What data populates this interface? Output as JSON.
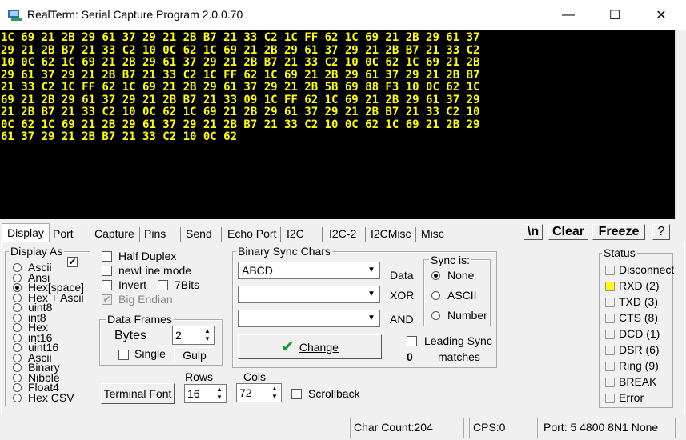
{
  "window": {
    "title": "RealTerm: Serial Capture Program 2.0.0.70",
    "minimize_icon": "minimize-icon",
    "maximize_icon": "maximize-icon",
    "close_icon": "close-icon",
    "minimize_glyph": "—",
    "maximize_glyph": "☐",
    "close_glyph": "✕"
  },
  "terminal": {
    "text_color": "#ffff00",
    "lines": [
      "1C 69 21 2B 29 61 37 29 21 2B B7 21 33 C2 1C FF 62 1C 69 21 2B 29 61 37",
      "29 21 2B B7 21 33 C2 10 0C 62 1C 69 21 2B 29 61 37 29 21 2B B7 21 33 C2",
      "10 0C 62 1C 69 21 2B 29 61 37 29 21 2B B7 21 33 C2 10 0C 62 1C 69 21 2B",
      "29 61 37 29 21 2B B7 21 33 C2 1C FF 62 1C 69 21 2B 29 61 37 29 21 2B B7",
      "21 33 C2 1C FF 62 1C 69 21 2B 29 61 37 29 21 2B 5B 69 88 F3 10 0C 62 1C",
      "69 21 2B 29 61 37 29 21 2B B7 21 33 09 1C FF 62 1C 69 21 2B 29 61 37 29",
      "21 2B B7 21 33 C2 10 0C 62 1C 69 21 2B 29 61 37 29 21 2B B7 21 33 C2 10",
      "0C 62 1C 69 21 2B 29 61 37 29 21 2B B7 21 33 C2 10 0C 62 1C 69 21 2B 29",
      "61 37 29 21 2B B7 21 33 C2 10 0C 62"
    ]
  },
  "tabs": [
    "Display",
    "Port",
    "Capture",
    "Pins",
    "Send",
    "Echo Port",
    "I2C",
    "I2C-2",
    "I2CMisc",
    "Misc"
  ],
  "toolbar": {
    "newline_label": "\\n",
    "clear_label": "Clear",
    "freeze_label": "Freeze",
    "help_label": "?"
  },
  "display_as": {
    "label": "Display As",
    "options": [
      "Ascii",
      "Ansi",
      "Hex[space]",
      "Hex + Ascii",
      "uint8",
      "int8",
      "Hex",
      "int16",
      "uint16",
      "Ascii",
      "Binary",
      "Nibble",
      "Float4",
      "Hex CSV"
    ],
    "selected_index": 2,
    "check_glyph": "✔"
  },
  "options": {
    "half_duplex": "Half Duplex",
    "newline_mode": "newLine mode",
    "invert": "Invert",
    "seven_bits": "7Bits",
    "big_endian": "Big Endian",
    "check_glyph": "✔"
  },
  "data_frames": {
    "label": "Data Frames",
    "bytes_label": "Bytes",
    "bytes_value": "2",
    "single_label": "Single",
    "gulp_label": "Gulp"
  },
  "terminal_font_label": "Terminal Font",
  "rows": {
    "label": "Rows",
    "value": "16"
  },
  "cols": {
    "label": "Cols",
    "value": "72"
  },
  "scrollback_label": "Scrollback",
  "binary_sync": {
    "label": "Binary Sync Chars",
    "data_value": "ABCD",
    "xor_value": "",
    "and_value": "",
    "data_label": "Data",
    "xor_label": "XOR",
    "and_label": "AND",
    "change_label": "Change",
    "change_icon": "green-checkmark-icon",
    "change_glyph": "✔",
    "dropdown_glyph": "▼",
    "leading_sync_label": "Leading Sync",
    "matches_label": "matches",
    "matches_count": "0",
    "sync_is": {
      "label": "Sync is:",
      "options": [
        "None",
        "ASCII",
        "Number"
      ],
      "selected_index": 0
    }
  },
  "status": {
    "label": "Status",
    "on_color": "#ffff00",
    "items": [
      {
        "label": "Disconnect",
        "led": false
      },
      {
        "label": "RXD (2)",
        "led": true
      },
      {
        "label": "TXD (3)",
        "led": false
      },
      {
        "label": "CTS (8)",
        "led": false
      },
      {
        "label": "DCD (1)",
        "led": false
      },
      {
        "label": "DSR (6)",
        "led": false
      },
      {
        "label": "Ring (9)",
        "led": false
      },
      {
        "label": "BREAK",
        "led": false
      },
      {
        "label": "Error",
        "led": false
      }
    ]
  },
  "statusbar": {
    "char_count": "Char Count:204",
    "cps": "CPS:0",
    "port": "Port: 5 4800 8N1 None"
  }
}
